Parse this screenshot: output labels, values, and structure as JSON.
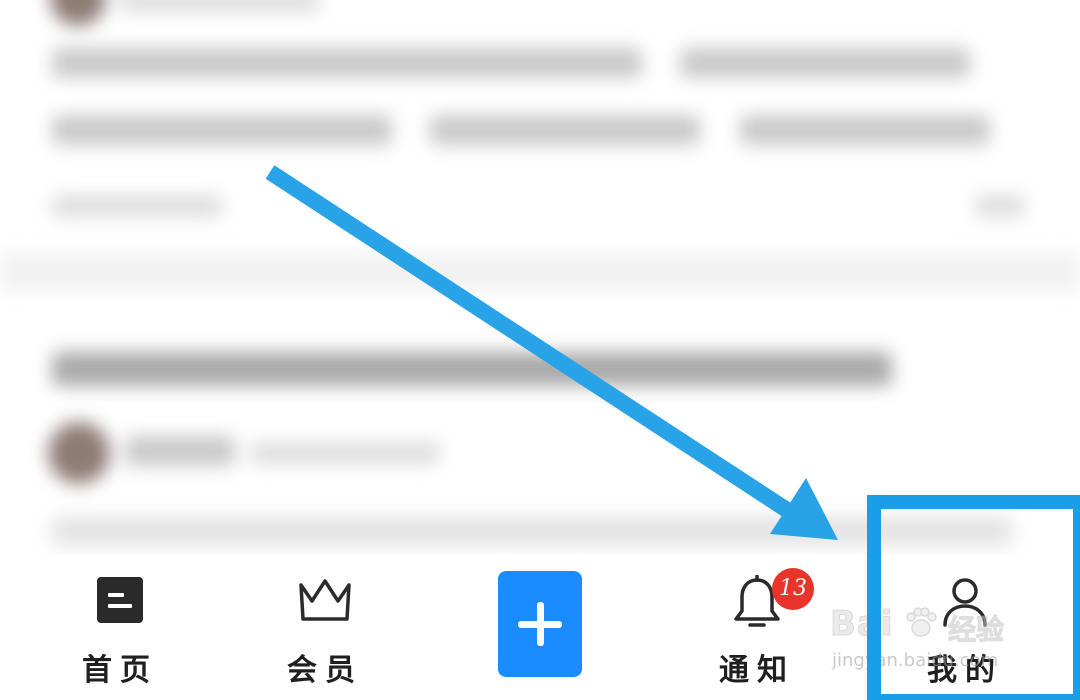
{
  "bottom_nav": {
    "items": [
      {
        "label": "首页",
        "icon": "home-doc-icon"
      },
      {
        "label": "会员",
        "icon": "crown-icon"
      },
      {
        "label": "通知",
        "icon": "bell-icon"
      },
      {
        "label": "我的",
        "icon": "person-icon"
      }
    ],
    "post_button_icon": "plus-icon",
    "notification_count": "13"
  },
  "watermark": {
    "brand": "Bai",
    "brand_sub": "经验",
    "url": "jingyan.baidu.com"
  },
  "annotation": {
    "arrow_color": "#29a3e8",
    "box_color": "#1a9ee8"
  },
  "colors": {
    "accent": "#1a8cff",
    "badge": "#e8342a",
    "text": "#1f1f1f"
  }
}
